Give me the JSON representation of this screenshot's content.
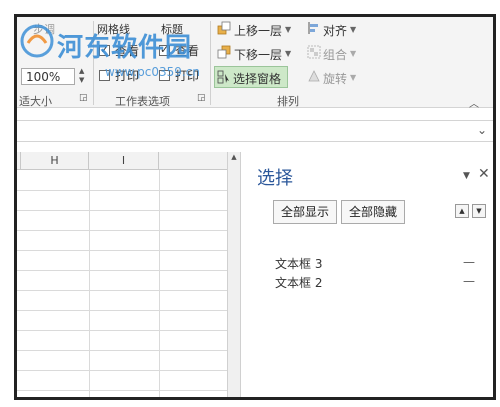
{
  "ribbon": {
    "partial_top_labels": [
      "步调",
      "网格线",
      "标题"
    ],
    "zoom_value": "100%",
    "zoom_group_label": "适大小",
    "gridlines": {
      "view_label": "查看",
      "print_label": "打印",
      "view_checked": true,
      "print_checked": false
    },
    "headings": {
      "view_label": "查看",
      "print_label": "打印",
      "view_checked": true,
      "print_checked": false
    },
    "sheet_options_label": "工作表选项",
    "bring_forward": "上移一层",
    "send_backward": "下移一层",
    "selection_pane": "选择窗格",
    "align": "对齐",
    "group": "组合",
    "rotate": "旋转",
    "arrange_label": "排列"
  },
  "grid": {
    "columns": [
      "H",
      "I"
    ]
  },
  "selection_pane": {
    "title": "选择",
    "show_all": "全部显示",
    "hide_all": "全部隐藏",
    "items": [
      {
        "name": "文本框 3",
        "visibility": "—"
      },
      {
        "name": "文本框 2",
        "visibility": "—"
      }
    ]
  },
  "watermark": {
    "title": "河东软件园",
    "url": "www.pc0359.cn"
  },
  "colors": {
    "pane_title": "#2b579a",
    "selected_button": "#cde8c8",
    "watermark": "#3d8fd6"
  }
}
